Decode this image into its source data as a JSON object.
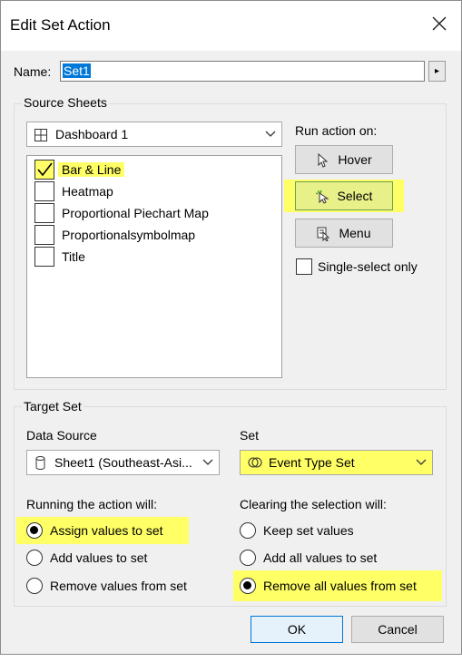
{
  "window": {
    "title": "Edit Set Action",
    "close_icon": "close-icon"
  },
  "name": {
    "label": "Name:",
    "value": "Set1",
    "arrow": "▸"
  },
  "source_sheets": {
    "group_label": "Source Sheets",
    "dashboard": "Dashboard 1",
    "sheets": [
      {
        "label": "Bar & Line",
        "checked": true
      },
      {
        "label": "Heatmap",
        "checked": false
      },
      {
        "label": "Proportional Piechart Map",
        "checked": false
      },
      {
        "label": "Proportionalsymbolmap",
        "checked": false
      },
      {
        "label": "Title",
        "checked": false
      }
    ],
    "run_action_label": "Run action on:",
    "hover_label": "Hover",
    "select_label": "Select",
    "menu_label": "Menu",
    "single_select_label": "Single-select only"
  },
  "target_set": {
    "group_label": "Target Set",
    "data_source_label": "Data Source",
    "data_source_value": "Sheet1 (Southeast-Asi...",
    "set_label": "Set",
    "set_value": "Event Type Set",
    "running_label": "Running the action will:",
    "running_options": [
      "Assign values to set",
      "Add values to set",
      "Remove values from set"
    ],
    "running_selected": 0,
    "clearing_label": "Clearing the selection will:",
    "clearing_options": [
      "Keep set values",
      "Add all values to set",
      "Remove all values from set"
    ],
    "clearing_selected": 2
  },
  "footer": {
    "ok_label": "OK",
    "cancel_label": "Cancel"
  },
  "colors": {
    "highlight": "#ffff66",
    "selection": "#0078d7"
  }
}
